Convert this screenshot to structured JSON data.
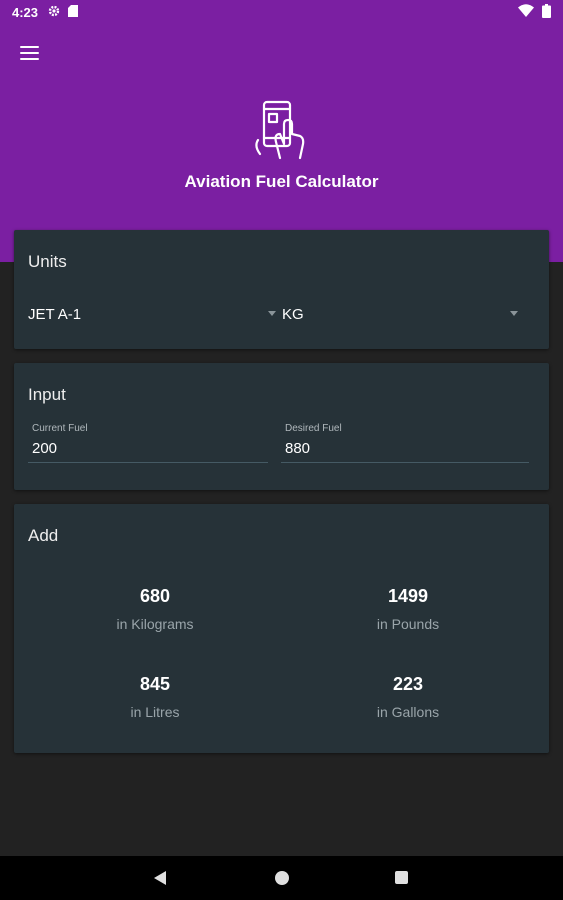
{
  "status_bar": {
    "time": "4:23",
    "left_icons": [
      "gear-icon",
      "sd-card-icon"
    ],
    "right_icons": [
      "wifi-icon",
      "battery-icon"
    ]
  },
  "header": {
    "title": "Aviation Fuel Calculator",
    "background_color": "#7B1FA2",
    "menu_icon": "hamburger-menu-icon",
    "logo_icon": "phone-hand-icon"
  },
  "units": {
    "title": "Units",
    "fuel_type": "JET A-1",
    "unit": "KG"
  },
  "input": {
    "title": "Input",
    "current_fuel_label": "Current Fuel",
    "current_fuel_value": "200",
    "desired_fuel_label": "Desired Fuel",
    "desired_fuel_value": "880"
  },
  "add": {
    "title": "Add",
    "results": [
      {
        "value": "680",
        "label": "in Kilograms"
      },
      {
        "value": "1499",
        "label": "in Pounds"
      },
      {
        "value": "845",
        "label": "in Litres"
      },
      {
        "value": "223",
        "label": "in Gallons"
      }
    ]
  },
  "nav_bar": {
    "icons": [
      "back-icon",
      "home-icon",
      "recents-icon"
    ]
  }
}
